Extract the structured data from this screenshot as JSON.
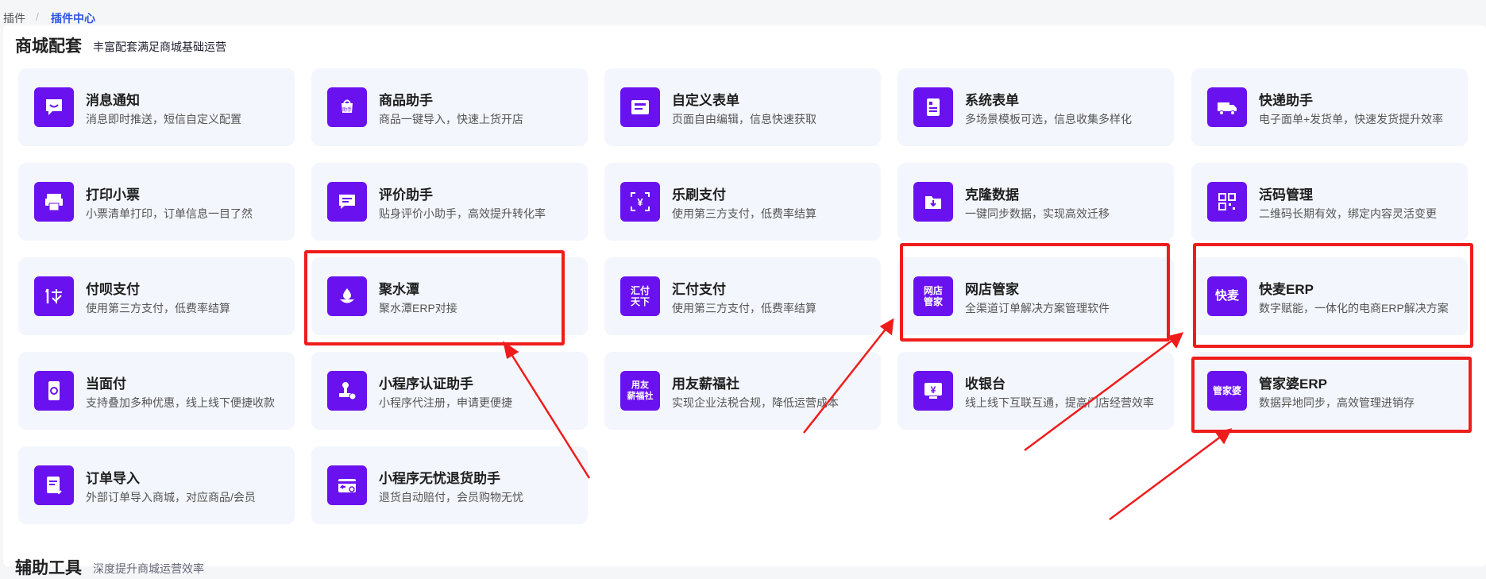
{
  "breadcrumb": {
    "root": "插件",
    "separator": "/",
    "current": "插件中心"
  },
  "section": {
    "title": "商城配套",
    "desc": "丰富配套满足商城基础运营"
  },
  "section2": {
    "title": "辅助工具",
    "desc": "深度提升商城运营效率"
  },
  "cards": [
    {
      "title": "消息通知",
      "desc": "消息即时推送，短信自定义配置",
      "icon": "chat-bubble-icon"
    },
    {
      "title": "商品助手",
      "desc": "商品一键导入，快速上货开店",
      "icon": "shopping-bag-icon",
      "icon_text": "助手"
    },
    {
      "title": "自定义表单",
      "desc": "页面自由编辑，信息快速获取",
      "icon": "form-icon"
    },
    {
      "title": "系统表单",
      "desc": "多场景模板可选，信息收集多样化",
      "icon": "document-icon"
    },
    {
      "title": "快递助手",
      "desc": "电子面单+发货单，快速发货提升效率",
      "icon": "truck-icon"
    },
    {
      "title": "打印小票",
      "desc": "小票清单打印，订单信息一目了然",
      "icon": "printer-icon"
    },
    {
      "title": "评价助手",
      "desc": "贴身评价小助手，高效提升转化率",
      "icon": "comment-icon"
    },
    {
      "title": "乐刷支付",
      "desc": "使用第三方支付，低费率结算",
      "icon": "yen-scan-icon"
    },
    {
      "title": "克隆数据",
      "desc": "一键同步数据，实现高效迁移",
      "icon": "folder-download-icon"
    },
    {
      "title": "活码管理",
      "desc": "二维码长期有效，绑定内容灵活变更",
      "icon": "qrcode-icon"
    },
    {
      "title": "付呗支付",
      "desc": "使用第三方支付，低费率结算",
      "icon": "fubei-pay-icon"
    },
    {
      "title": "聚水潭",
      "desc": "聚水潭ERP对接",
      "icon": "water-drop-icon"
    },
    {
      "title": "汇付支付",
      "desc": "使用第三方支付，低费率结算",
      "icon": "huifu-logo-icon",
      "icon_text": "汇付\n天下"
    },
    {
      "title": "网店管家",
      "desc": "全渠道订单解决方案管理软件",
      "icon": "wangdian-logo-icon",
      "icon_text": "网店\n管家"
    },
    {
      "title": "快麦ERP",
      "desc": "数字赋能，一体化的电商ERP解决方案",
      "icon": "kuaimai-logo-icon",
      "icon_text": "快麦"
    },
    {
      "title": "当面付",
      "desc": "支持叠加多种优惠，线上线下便捷收款",
      "icon": "phone-pay-icon"
    },
    {
      "title": "小程序认证助手",
      "desc": "小程序代注册，申请更便捷",
      "icon": "stamp-icon"
    },
    {
      "title": "用友薪福社",
      "desc": "实现企业法税合规，降低运营成本",
      "icon": "yonyou-logo-icon",
      "icon_text": "用友\n薪福社"
    },
    {
      "title": "收银台",
      "desc": "线上线下互联互通，提高门店经营效率",
      "icon": "cashier-icon"
    },
    {
      "title": "管家婆ERP",
      "desc": "数据异地同步，高效管理进销存",
      "icon": "guanjiapo-logo-icon",
      "icon_text": "管家婆"
    },
    {
      "title": "订单导入",
      "desc": "外部订单导入商城，对应商品/会员",
      "icon": "order-import-icon"
    },
    {
      "title": "小程序无忧退货助手",
      "desc": "退货自动赔付，会员购物无忧",
      "icon": "return-goods-icon"
    }
  ],
  "colors": {
    "icon_bg": "#6a11f0",
    "card_bg": "#f3f6fc",
    "highlight": "#ef1c1c",
    "link": "#2d55e6"
  }
}
